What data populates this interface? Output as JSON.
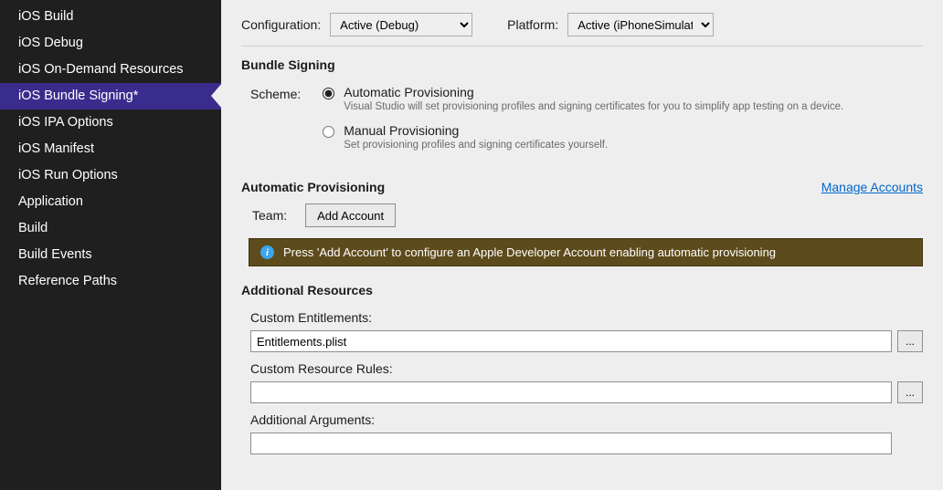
{
  "sidebar": {
    "items": [
      {
        "label": "iOS Build"
      },
      {
        "label": "iOS Debug"
      },
      {
        "label": "iOS On-Demand Resources"
      },
      {
        "label": "iOS Bundle Signing*"
      },
      {
        "label": "iOS IPA Options"
      },
      {
        "label": "iOS Manifest"
      },
      {
        "label": "iOS Run Options"
      },
      {
        "label": "Application"
      },
      {
        "label": "Build"
      },
      {
        "label": "Build Events"
      },
      {
        "label": "Reference Paths"
      }
    ],
    "selected_index": 3
  },
  "top": {
    "config_label": "Configuration:",
    "config_value": "Active (Debug)",
    "platform_label": "Platform:",
    "platform_value": "Active (iPhoneSimulator)"
  },
  "bundle_signing": {
    "title": "Bundle Signing",
    "scheme_label": "Scheme:",
    "options": {
      "auto": {
        "title": "Automatic Provisioning",
        "desc": "Visual Studio will set provisioning profiles and signing certificates for you to simplify app testing on a device."
      },
      "manual": {
        "title": "Manual Provisioning",
        "desc": "Set provisioning profiles and signing certificates yourself."
      }
    },
    "selected_scheme": "auto"
  },
  "auto_prov": {
    "title": "Automatic Provisioning",
    "manage_link": "Manage Accounts",
    "team_label": "Team:",
    "add_account_btn": "Add Account",
    "info_msg": "Press 'Add Account' to configure an Apple Developer Account enabling automatic provisioning"
  },
  "resources": {
    "title": "Additional Resources",
    "entitlements_label": "Custom Entitlements:",
    "entitlements_value": "Entitlements.plist",
    "rules_label": "Custom Resource Rules:",
    "rules_value": "",
    "args_label": "Additional Arguments:",
    "args_value": "",
    "browse_label": "..."
  }
}
